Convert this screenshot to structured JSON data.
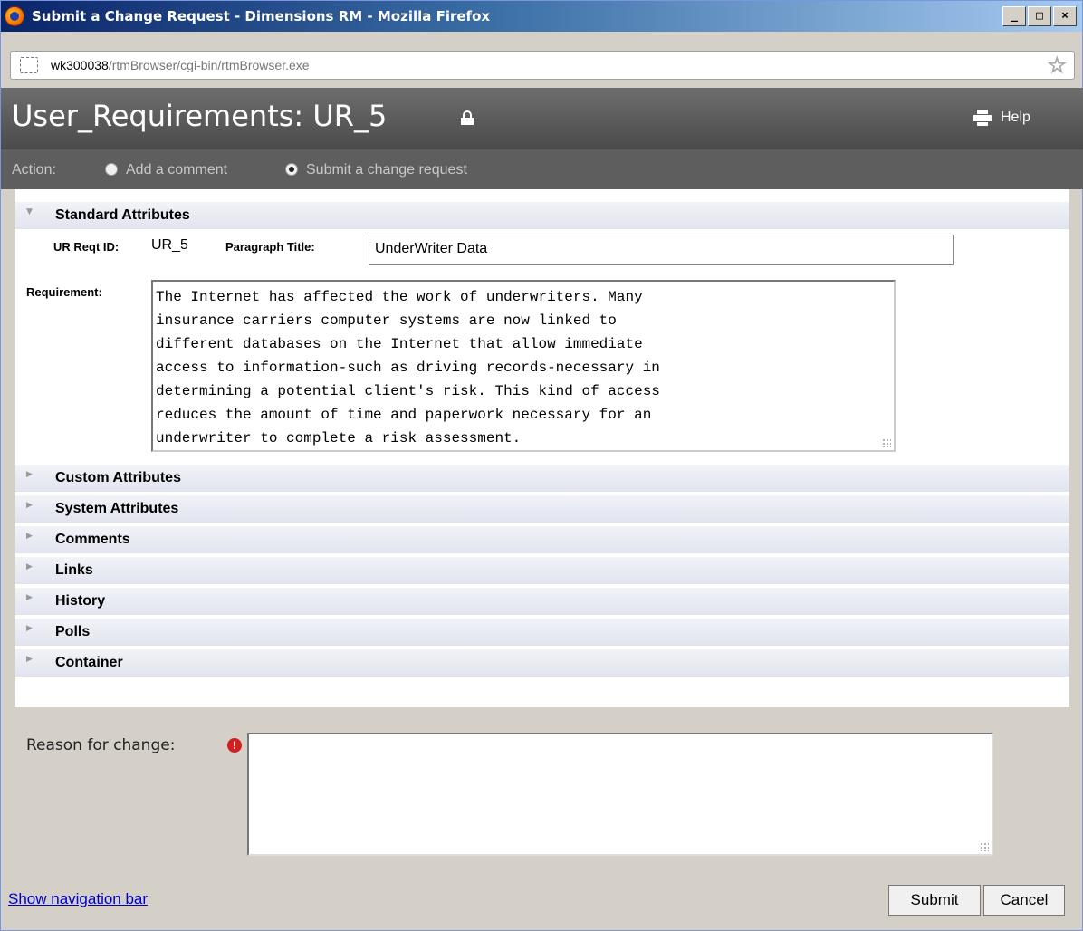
{
  "window": {
    "title": "Submit a Change Request - Dimensions RM - Mozilla Firefox",
    "buttons": {
      "minimize": "_",
      "maximize": "□",
      "close": "×"
    }
  },
  "address": {
    "host": "wk300038",
    "path": "/rtmBrowser/cgi-bin/rtmBrowser.exe"
  },
  "header": {
    "title": "User_Requirements: UR_5",
    "help_label": "Help"
  },
  "action": {
    "label": "Action:",
    "options": [
      {
        "label": "Add a comment",
        "selected": false
      },
      {
        "label": "Submit a change request",
        "selected": true
      }
    ]
  },
  "sections": [
    {
      "label": "Standard Attributes",
      "expanded": true
    },
    {
      "label": "Custom Attributes",
      "expanded": false
    },
    {
      "label": "System Attributes",
      "expanded": false
    },
    {
      "label": "Comments",
      "expanded": false
    },
    {
      "label": "Links",
      "expanded": false
    },
    {
      "label": "History",
      "expanded": false
    },
    {
      "label": "Polls",
      "expanded": false
    },
    {
      "label": "Container",
      "expanded": false
    }
  ],
  "standard": {
    "reqt_id_label": "UR Reqt ID:",
    "reqt_id_value": "UR_5",
    "paragraph_title_label": "Paragraph Title:",
    "paragraph_title_value": "UnderWriter Data",
    "requirement_label": "Requirement:",
    "requirement_value": "The Internet has affected the work of underwriters. Many\ninsurance carriers computer systems are now linked to\ndifferent databases on the Internet that allow immediate\naccess to information-such as driving records-necessary in\ndetermining a potential client's risk. This kind of access\nreduces the amount of time and paperwork necessary for an\nunderwriter to complete a risk assessment."
  },
  "reason": {
    "label": "Reason for change:",
    "value": ""
  },
  "footer": {
    "nav_link": "Show navigation bar",
    "submit_label": "Submit",
    "cancel_label": "Cancel"
  }
}
